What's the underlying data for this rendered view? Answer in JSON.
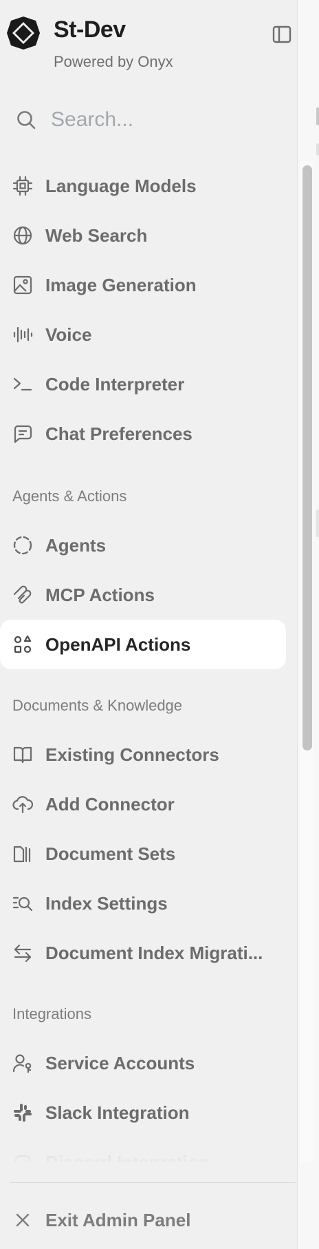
{
  "header": {
    "title": "St-Dev",
    "subtitle": "Powered by Onyx",
    "logo_icon": "onyx-logo",
    "toggle_icon": "sidebar-toggle-icon"
  },
  "search": {
    "placeholder": "Search...",
    "value": ""
  },
  "nav": {
    "settings": [
      {
        "label": "Language Models",
        "icon": "cpu-chip-icon"
      },
      {
        "label": "Web Search",
        "icon": "globe-icon"
      },
      {
        "label": "Image Generation",
        "icon": "image-icon"
      },
      {
        "label": "Voice",
        "icon": "audio-wave-icon"
      },
      {
        "label": "Code Interpreter",
        "icon": "terminal-prompt-icon"
      },
      {
        "label": "Chat Preferences",
        "icon": "chat-bubble-icon"
      }
    ],
    "agents_section": "Agents & Actions",
    "agents": [
      {
        "label": "Agents",
        "icon": "dashed-circle-icon"
      },
      {
        "label": "MCP Actions",
        "icon": "mcp-icon"
      },
      {
        "label": "OpenAPI Actions",
        "icon": "shapes-icon",
        "active": true
      }
    ],
    "documents_section": "Documents & Knowledge",
    "documents": [
      {
        "label": "Existing Connectors",
        "icon": "book-open-icon"
      },
      {
        "label": "Add Connector",
        "icon": "cloud-upload-icon"
      },
      {
        "label": "Document Sets",
        "icon": "document-stack-icon"
      },
      {
        "label": "Index Settings",
        "icon": "search-list-icon"
      },
      {
        "label": "Document Index Migrati...",
        "icon": "swap-arrows-icon"
      }
    ],
    "integrations_section": "Integrations",
    "integrations": [
      {
        "label": "Service Accounts",
        "icon": "user-key-icon"
      },
      {
        "label": "Slack Integration",
        "icon": "slack-icon"
      },
      {
        "label": "Discord Integration",
        "icon": "discord-icon"
      }
    ]
  },
  "footer": {
    "exit_label": "Exit Admin Panel",
    "exit_icon": "close-icon"
  },
  "colors": {
    "background": "#f0f0f0",
    "active_item": "#ffffff",
    "label": "#6c6c6c",
    "active_label": "#262626",
    "section_label": "#7d7d7d"
  }
}
